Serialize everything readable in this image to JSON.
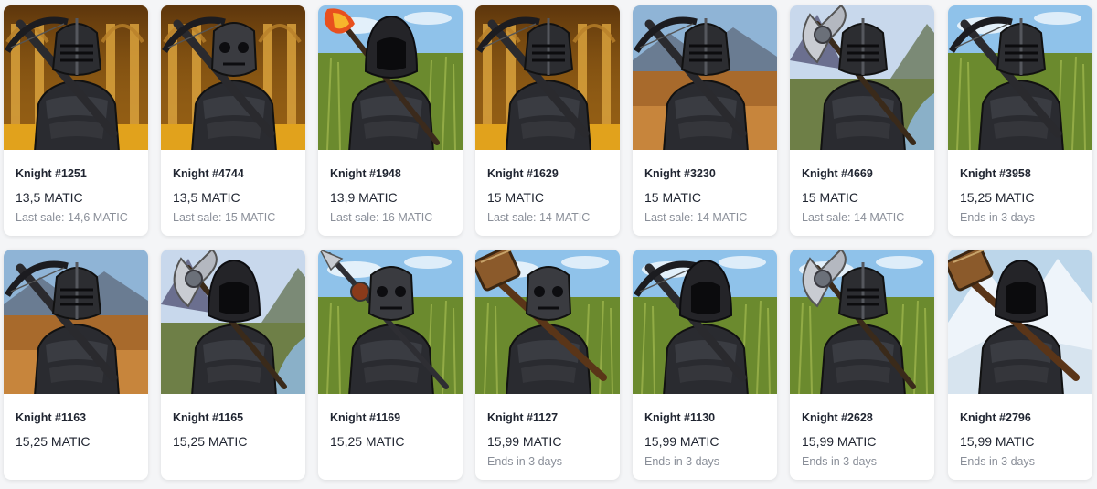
{
  "colors": {
    "card_bg": "#ffffff",
    "page_bg": "#f4f5f7",
    "text_primary": "#1f2430",
    "text_secondary": "#8a8f99"
  },
  "items": [
    {
      "name": "Knight #1251",
      "price": "13,5 MATIC",
      "sub": "Last sale: 14,6 MATIC",
      "bg": "hall",
      "weapon": "crossbow",
      "head": "helmet"
    },
    {
      "name": "Knight #4744",
      "price": "13,5 MATIC",
      "sub": "Last sale: 15 MATIC",
      "bg": "hall",
      "weapon": "crossbow",
      "head": "skull"
    },
    {
      "name": "Knight #1948",
      "price": "13,9 MATIC",
      "sub": "Last sale: 16 MATIC",
      "bg": "field",
      "weapon": "fire-staff",
      "head": "hood"
    },
    {
      "name": "Knight #1629",
      "price": "15 MATIC",
      "sub": "Last sale: 14 MATIC",
      "bg": "hall",
      "weapon": "crossbow",
      "head": "helmet"
    },
    {
      "name": "Knight #3230",
      "price": "15 MATIC",
      "sub": "Last sale: 14 MATIC",
      "bg": "autumn",
      "weapon": "crossbow",
      "head": "helmet"
    },
    {
      "name": "Knight #4669",
      "price": "15 MATIC",
      "sub": "Last sale: 14 MATIC",
      "bg": "valley",
      "weapon": "axe",
      "head": "helmet"
    },
    {
      "name": "Knight #3958",
      "price": "15,25 MATIC",
      "sub": "Ends in 3 days",
      "bg": "field",
      "weapon": "crossbow",
      "head": "helmet"
    },
    {
      "name": "Knight #1163",
      "price": "15,25 MATIC",
      "sub": "",
      "bg": "autumn",
      "weapon": "crossbow",
      "head": "helmet"
    },
    {
      "name": "Knight #1165",
      "price": "15,25 MATIC",
      "sub": "",
      "bg": "valley",
      "weapon": "axe",
      "head": "hood"
    },
    {
      "name": "Knight #1169",
      "price": "15,25 MATIC",
      "sub": "",
      "bg": "field",
      "weapon": "spear",
      "head": "skull"
    },
    {
      "name": "Knight #1127",
      "price": "15,99 MATIC",
      "sub": "Ends in 3 days",
      "bg": "field",
      "weapon": "hammer",
      "head": "skull"
    },
    {
      "name": "Knight #1130",
      "price": "15,99 MATIC",
      "sub": "Ends in 3 days",
      "bg": "field",
      "weapon": "crossbow",
      "head": "hood"
    },
    {
      "name": "Knight #2628",
      "price": "15,99 MATIC",
      "sub": "Ends in 3 days",
      "bg": "field",
      "weapon": "axe",
      "head": "helmet"
    },
    {
      "name": "Knight #2796",
      "price": "15,99 MATIC",
      "sub": "Ends in 3 days",
      "bg": "snow",
      "weapon": "hammer",
      "head": "hood"
    }
  ]
}
